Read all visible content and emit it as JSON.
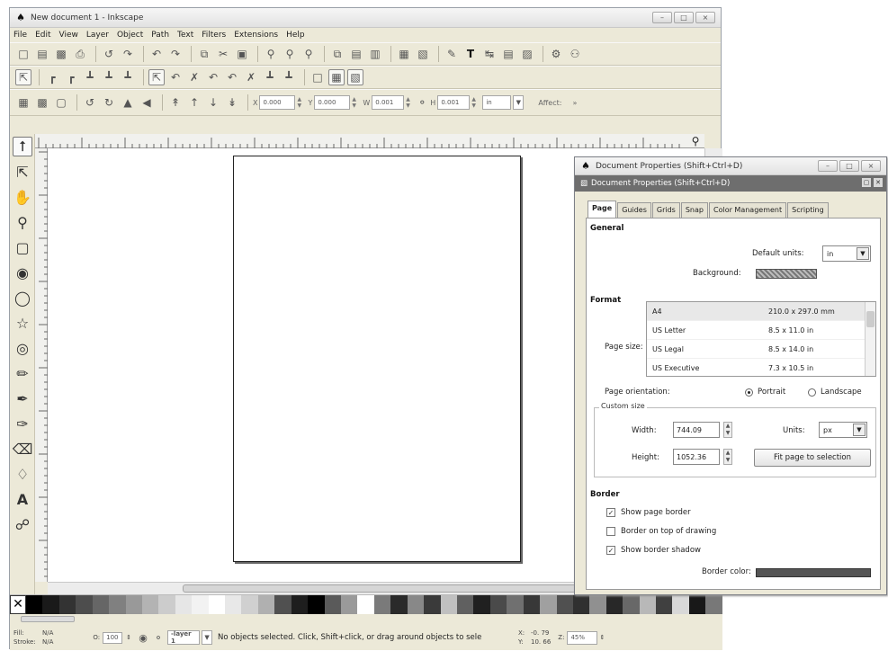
{
  "window": {
    "title": "New document 1 - Inkscape",
    "buttons": [
      "–",
      "□",
      "×"
    ]
  },
  "menu": [
    "File",
    "Edit",
    "View",
    "Layer",
    "Object",
    "Path",
    "Text",
    "Filters",
    "Extensions",
    "Help"
  ],
  "toolbar_controls": {
    "x_label": "X",
    "x_value": "0.000",
    "y_label": "Y",
    "y_value": "0.000",
    "w_label": "W",
    "w_value": "0.001",
    "h_label": "H",
    "h_value": "0.001",
    "units": "in",
    "affect": "Affect:"
  },
  "palette_colors": [
    "#000000",
    "#1a1a1a",
    "#333333",
    "#4d4d4d",
    "#666666",
    "#808080",
    "#999999",
    "#b3b3b3",
    "#cccccc",
    "#e6e6e6",
    "#f2f2f2",
    "#ffffff",
    "#e8e8e8",
    "#d0d0d0",
    "#b0b0b0",
    "#505050",
    "#1e1e1e",
    "#000000",
    "#5a5a5a",
    "#9a9a9a",
    "#ffffff",
    "#7a7a7a",
    "#2a2a2a",
    "#888888",
    "#3a3a3a",
    "#c0c0c0",
    "#606060",
    "#202020",
    "#4a4a4a",
    "#707070",
    "#383838",
    "#a0a0a0",
    "#505050",
    "#303030",
    "#909090",
    "#282828",
    "#686868",
    "#b8b8b8",
    "#404040",
    "#d8d8d8",
    "#181818",
    "#787878"
  ],
  "status": {
    "fill_label": "Fill:",
    "fill_value": "N/A",
    "stroke_label": "Stroke:",
    "stroke_value": "N/A",
    "opacity_label": "O:",
    "opacity_value": "100",
    "layer": "-layer 1",
    "message": "No objects selected. Click, Shift+click, or drag around objects to sele",
    "x_label": "X:",
    "x_value": "-0. 79",
    "y_label": "Y:",
    "y_value": "10. 66",
    "zoom_label": "Z:",
    "zoom_value": "45%"
  },
  "docprops": {
    "title": "Document Properties (Shift+Ctrl+D)",
    "subtitle": "Document Properties (Shift+Ctrl+D)",
    "tabs": [
      "Page",
      "Guides",
      "Grids",
      "Snap",
      "Color Management",
      "Scripting"
    ],
    "general_heading": "General",
    "default_units_label": "Default units:",
    "default_units_value": "in",
    "background_label": "Background:",
    "format_heading": "Format",
    "page_size_label": "Page size:",
    "page_sizes": [
      {
        "name": "A4",
        "dims": "210.0 x 297.0 mm"
      },
      {
        "name": "US Letter",
        "dims": "8.5 x 11.0 in"
      },
      {
        "name": "US Legal",
        "dims": "8.5 x 14.0 in"
      },
      {
        "name": "US Executive",
        "dims": "7.3 x 10.5 in"
      }
    ],
    "orientation_label": "Page orientation:",
    "portrait": "Portrait",
    "landscape": "Landscape",
    "custom_size_label": "Custom size",
    "width_label": "Width:",
    "width_value": "744.09",
    "height_label": "Height:",
    "height_value": "1052.36",
    "units_label": "Units:",
    "units_value": "px",
    "fit_button": "Fit page to selection",
    "border_heading": "Border",
    "show_page_border": "Show page border",
    "border_on_top": "Border on top of drawing",
    "show_border_shadow": "Show border shadow",
    "border_color_label": "Border color:"
  }
}
